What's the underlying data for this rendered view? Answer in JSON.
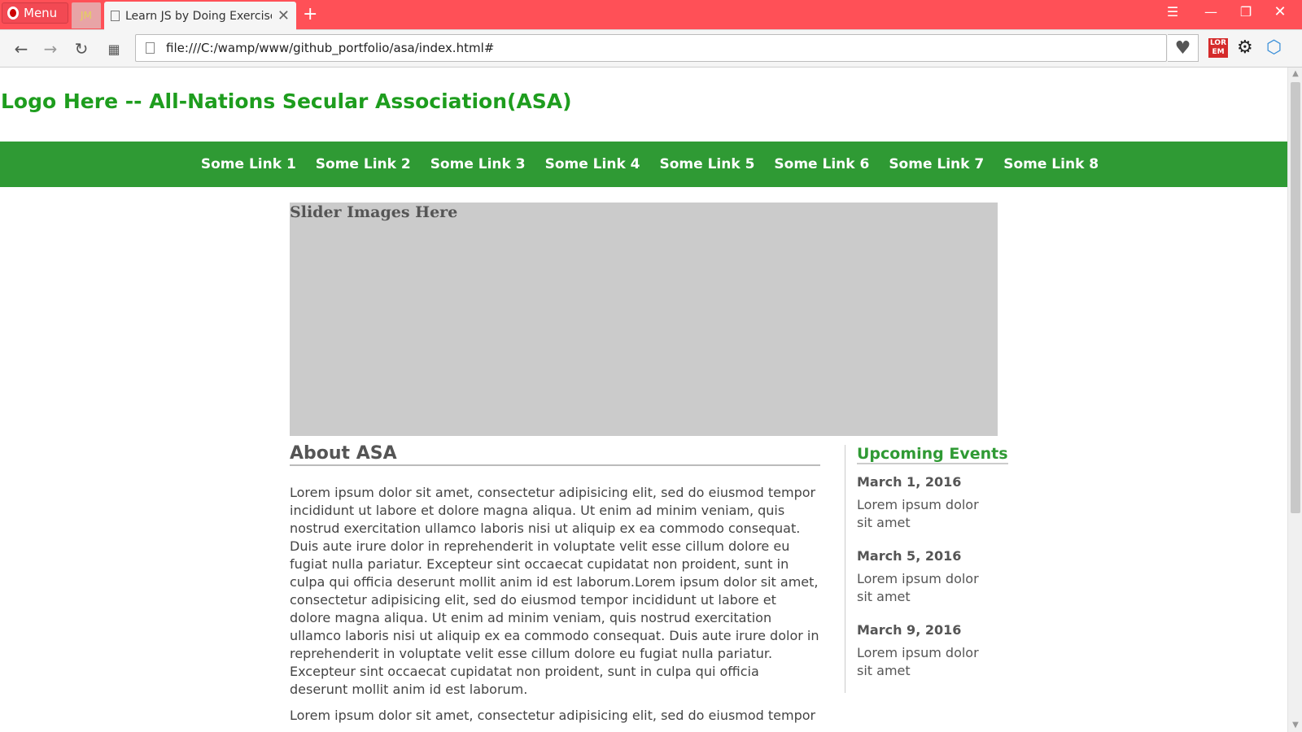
{
  "browser": {
    "menu_label": "Menu",
    "pinned_tab_label": "JM",
    "tab_title": "Learn JS by Doing Exercises",
    "address": "file:///C:/wamp/www/github_portfolio/asa/index.html#",
    "lorem_badge_line1": "LOR",
    "lorem_badge_line2": "EM",
    "accent_color": "#ff5057"
  },
  "site": {
    "logo_text": "Logo Here -- All-Nations Secular Association(ASA)",
    "nav_links": [
      "Some Link 1",
      "Some Link 2",
      "Some Link 3",
      "Some Link 4",
      "Some Link 5",
      "Some Link 6",
      "Some Link 7",
      "Some Link 8"
    ],
    "slider_text": "Slider Images Here",
    "about": {
      "heading": "About ASA",
      "paragraphs": [
        "Lorem ipsum dolor sit amet, consectetur adipisicing elit, sed do eiusmod tempor incididunt ut labore et dolore magna aliqua. Ut enim ad minim veniam, quis nostrud exercitation ullamco laboris nisi ut aliquip ex ea commodo consequat. Duis aute irure dolor in reprehenderit in voluptate velit esse cillum dolore eu fugiat nulla pariatur. Excepteur sint occaecat cupidatat non proident, sunt in culpa qui officia deserunt mollit anim id est laborum.Lorem ipsum dolor sit amet, consectetur adipisicing elit, sed do eiusmod tempor incididunt ut labore et dolore magna aliqua. Ut enim ad minim veniam, quis nostrud exercitation ullamco laboris nisi ut aliquip ex ea commodo consequat. Duis aute irure dolor in reprehenderit in voluptate velit esse cillum dolore eu fugiat nulla pariatur. Excepteur sint occaecat cupidatat non proident, sunt in culpa qui officia deserunt mollit anim id est laborum.",
        "Lorem ipsum dolor sit amet, consectetur adipisicing elit, sed do eiusmod tempor"
      ]
    },
    "events": {
      "heading": "Upcoming Events",
      "items": [
        {
          "date": "March 1, 2016",
          "desc": "Lorem ipsum dolor sit amet"
        },
        {
          "date": "March 5, 2016",
          "desc": "Lorem ipsum dolor sit amet"
        },
        {
          "date": "March 9, 2016",
          "desc": "Lorem ipsum dolor sit amet"
        }
      ]
    },
    "colors": {
      "brand_green": "#1e9d1e",
      "nav_green": "#2f9a34",
      "slider_gray": "#cbcbcb"
    }
  },
  "icons": [
    "opera-icon",
    "document-icon",
    "close-icon",
    "plus-icon",
    "back-icon",
    "forward-icon",
    "reload-icon",
    "speed-dial-icon",
    "heart-icon",
    "lorem-icon",
    "gear-icon",
    "extension-icon"
  ]
}
